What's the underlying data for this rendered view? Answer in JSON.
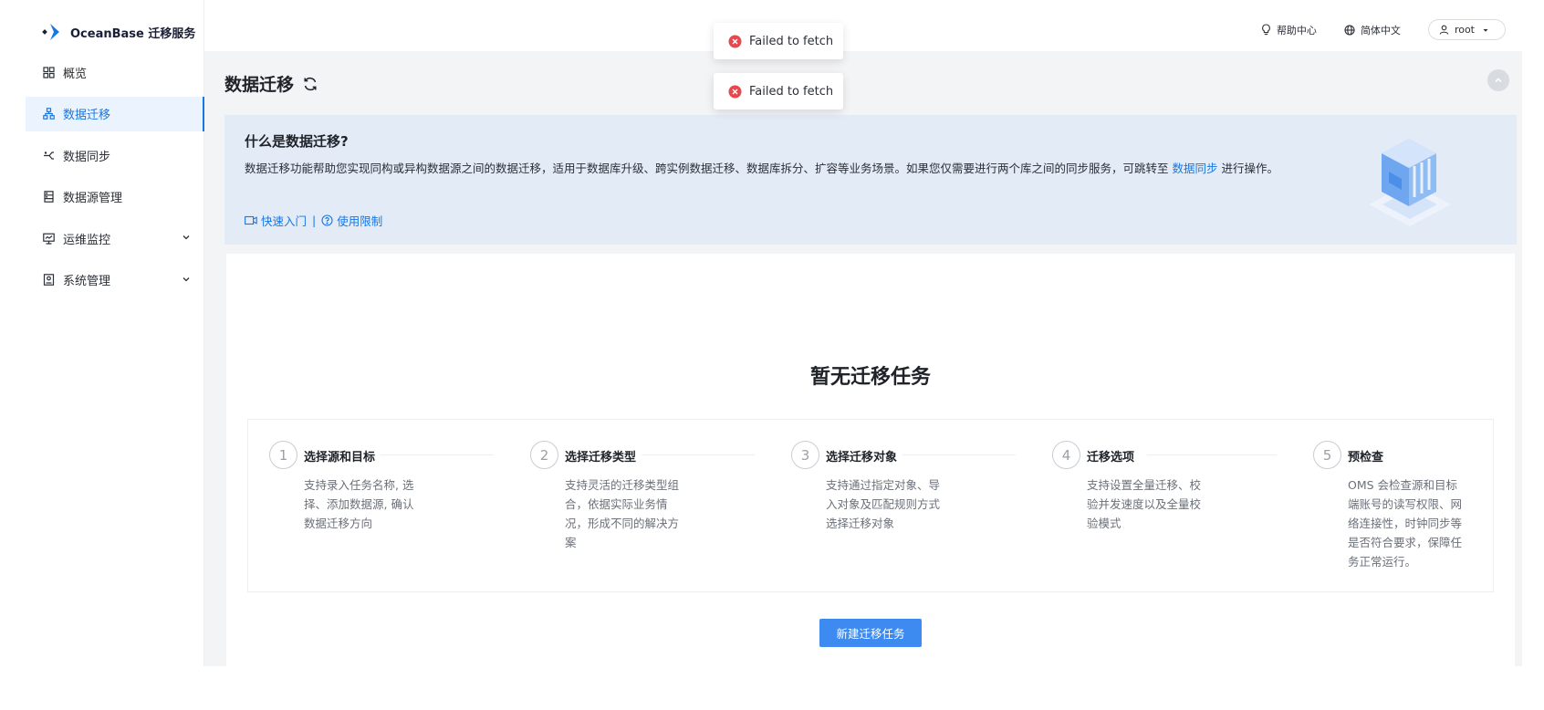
{
  "app": {
    "brand": "OceanBase 迁移服务",
    "brand_color": "#1677e5"
  },
  "sidebar": {
    "items": [
      {
        "label": "概览",
        "icon": "grid-icon",
        "active": false
      },
      {
        "label": "数据迁移",
        "icon": "migration-icon",
        "active": true
      },
      {
        "label": "数据同步",
        "icon": "sync-icon",
        "active": false
      },
      {
        "label": "数据源管理",
        "icon": "datasource-icon",
        "active": false
      },
      {
        "label": "运维监控",
        "icon": "monitor-icon",
        "active": false,
        "expandable": true
      },
      {
        "label": "系统管理",
        "icon": "system-icon",
        "active": false,
        "expandable": true
      }
    ]
  },
  "header": {
    "help": "帮助中心",
    "language": "简体中文",
    "user": "root"
  },
  "toasts": [
    {
      "message": "Failed to fetch",
      "type": "error"
    },
    {
      "message": "Failed to fetch",
      "type": "error"
    }
  ],
  "page": {
    "title": "数据迁移"
  },
  "intro": {
    "title": "什么是数据迁移?",
    "desc_before": "数据迁移功能帮助您实现同构或异构数据源之间的数据迁移，适用于数据库升级、跨实例数据迁移、数据库拆分、扩容等业务场景。如果您仅需要进行两个库之间的同步服务，可跳转至 ",
    "desc_link": "数据同步",
    "desc_after": " 进行操作。",
    "quick_start": "快速入门",
    "separator": "|",
    "limits": "使用限制"
  },
  "empty": {
    "title": "暂无迁移任务",
    "new_button": "新建迁移任务"
  },
  "steps": [
    {
      "num": "1",
      "title": "选择源和目标",
      "desc": "支持录入任务名称, 选择、添加数据源, 确认数据迁移方向"
    },
    {
      "num": "2",
      "title": "选择迁移类型",
      "desc": "支持灵活的迁移类型组合，依据实际业务情况，形成不同的解决方案"
    },
    {
      "num": "3",
      "title": "选择迁移对象",
      "desc": "支持通过指定对象、导入对象及匹配规则方式选择迁移对象"
    },
    {
      "num": "4",
      "title": "迁移选项",
      "desc": "支持设置全量迁移、校验并发速度以及全量校验模式"
    },
    {
      "num": "5",
      "title": "预检查",
      "desc": "OMS 会检查源和目标端账号的读写权限、网络连接性，时钟同步等是否符合要求，保障任务正常运行。"
    }
  ]
}
